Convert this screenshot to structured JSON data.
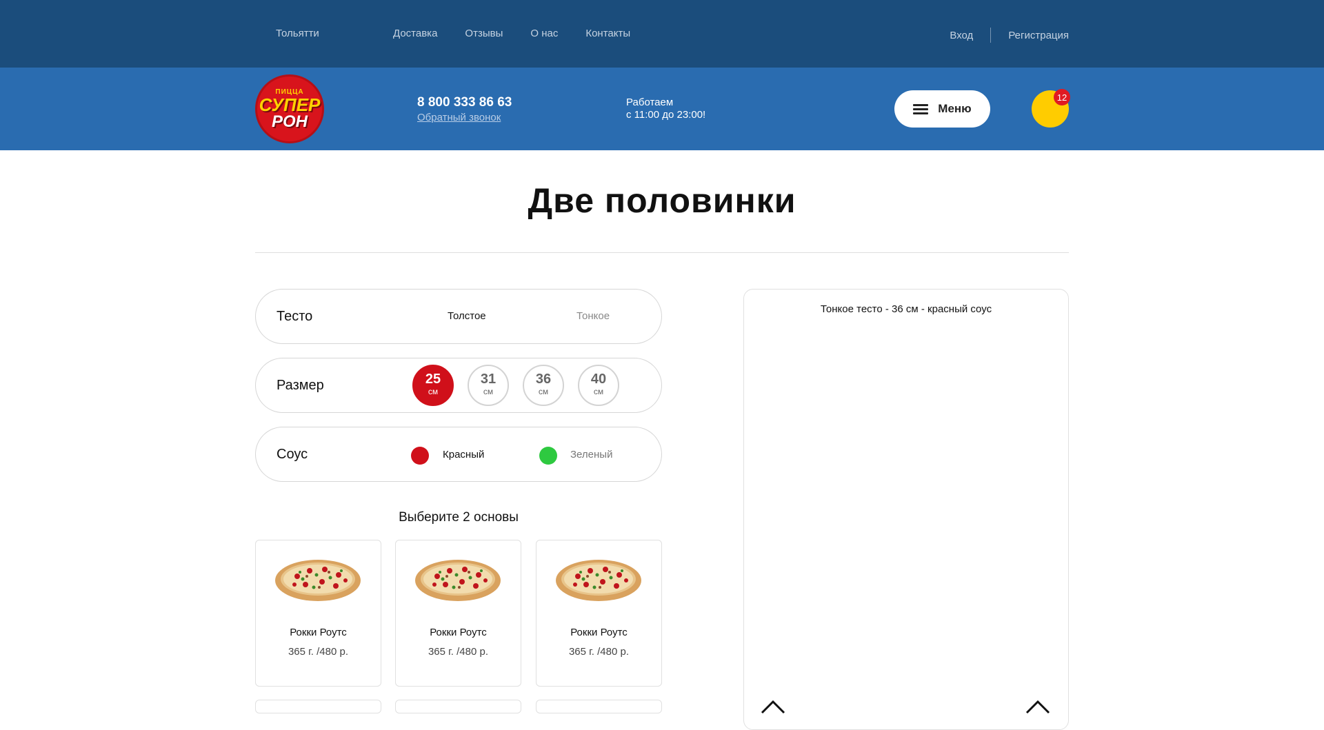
{
  "topbar": {
    "city": "Тольятти",
    "nav": [
      "Доставка",
      "Отзывы",
      "О нас",
      "Контакты"
    ],
    "login": "Вход",
    "register": "Регистрация"
  },
  "header": {
    "logo_top": "ПИЦЦА",
    "logo_mid": "СУПЕР",
    "logo_bot": "РОН",
    "phone": "8 800 333 86 63",
    "callback": "Обратный звонок",
    "hours_line1": "Работаем",
    "hours_line2": "с 11:00 до 23:00!",
    "menu_label": "Меню",
    "cart_count": "12"
  },
  "colors": {
    "topbar_bg": "#1b4d7c",
    "header_bg": "#2a6cb0",
    "accent_red": "#d0101a",
    "cart_yellow": "#ffcc00",
    "sauce_red": "#d0101a",
    "sauce_green": "#2ec940"
  },
  "page": {
    "title": "Две половинки"
  },
  "options": {
    "dough": {
      "label": "Тесто",
      "choices": [
        "Толстое",
        "Тонкое"
      ],
      "selected": "Толстое"
    },
    "size": {
      "label": "Размер",
      "unit": "см",
      "values": [
        "25",
        "31",
        "36",
        "40"
      ],
      "selected": "25"
    },
    "sauce": {
      "label": "Соус",
      "choices": [
        "Красный",
        "Зеленый"
      ],
      "selected": "Красный"
    }
  },
  "bases": {
    "heading": "Выберите 2 основы",
    "items": [
      {
        "name": "Рокки Роутс",
        "price": "365 г. /480 р."
      },
      {
        "name": "Рокки Роутс",
        "price": "365 г. /480 р."
      },
      {
        "name": "Рокки Роутс",
        "price": "365 г. /480 р."
      }
    ]
  },
  "preview": {
    "title": "Тонкое тесто - 36 см - красный соус"
  },
  "icons": {
    "menu": "burger-icon",
    "cart": "cart-icon",
    "arrows": "chevron-up-icon"
  }
}
